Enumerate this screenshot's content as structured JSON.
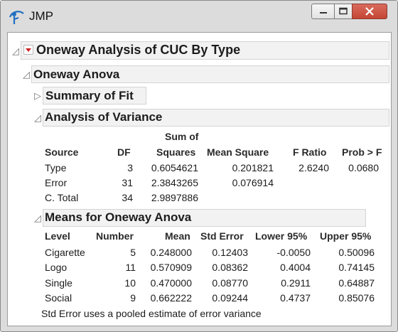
{
  "window": {
    "title": "JMP",
    "controls": [
      "minimize-icon",
      "maximize-icon",
      "close-icon"
    ]
  },
  "report": {
    "title": "Oneway Analysis of CUC By Type",
    "sections": {
      "oneway_anova": "Oneway Anova",
      "summary_of_fit": "Summary of Fit",
      "analysis_of_variance": "Analysis of Variance",
      "means": "Means for Oneway Anova"
    }
  },
  "anova_table": {
    "headers": {
      "source": "Source",
      "df": "DF",
      "ss_line1": "Sum of",
      "ss_line2": "Squares",
      "ms": "Mean Square",
      "f": "F Ratio",
      "p": "Prob > F"
    },
    "rows": [
      {
        "source": "Type",
        "df": "3",
        "ss": "0.6054621",
        "ms": "0.201821",
        "f": "2.6240",
        "p": "0.0680"
      },
      {
        "source": "Error",
        "df": "31",
        "ss": "2.3843265",
        "ms": "0.076914",
        "f": "",
        "p": ""
      },
      {
        "source": "C. Total",
        "df": "34",
        "ss": "2.9897886",
        "ms": "",
        "f": "",
        "p": ""
      }
    ]
  },
  "means_table": {
    "headers": {
      "level": "Level",
      "number": "Number",
      "mean": "Mean",
      "se": "Std Error",
      "lower": "Lower 95%",
      "upper": "Upper 95%"
    },
    "rows": [
      {
        "level": "Cigarette",
        "number": "5",
        "mean": "0.248000",
        "se": "0.12403",
        "lower": "-0.0050",
        "upper": "0.50096"
      },
      {
        "level": "Logo",
        "number": "11",
        "mean": "0.570909",
        "se": "0.08362",
        "lower": "0.4004",
        "upper": "0.74145"
      },
      {
        "level": "Single",
        "number": "10",
        "mean": "0.470000",
        "se": "0.08770",
        "lower": "0.2911",
        "upper": "0.64887"
      },
      {
        "level": "Social",
        "number": "9",
        "mean": "0.662222",
        "se": "0.09244",
        "lower": "0.4737",
        "upper": "0.85076"
      }
    ],
    "note": "Std Error uses a pooled estimate of error variance"
  },
  "colors": {
    "close_button": "#c44634",
    "red_triangle": "#cc2222",
    "outline_bar": "#f2f2f2",
    "app_icon_blue": "#1f6fc0"
  }
}
